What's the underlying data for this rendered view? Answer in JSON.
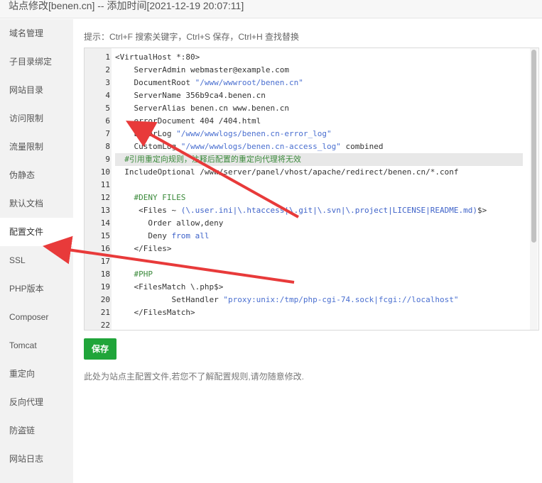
{
  "window": {
    "title": "站点修改[benen.cn] -- 添加时间[2021-12-19 20:07:11]"
  },
  "sidebar": {
    "items": [
      {
        "label": "域名管理",
        "active": false
      },
      {
        "label": "子目录绑定",
        "active": false
      },
      {
        "label": "网站目录",
        "active": false
      },
      {
        "label": "访问限制",
        "active": false
      },
      {
        "label": "流量限制",
        "active": false
      },
      {
        "label": "伪静态",
        "active": false
      },
      {
        "label": "默认文档",
        "active": false
      },
      {
        "label": "配置文件",
        "active": true
      },
      {
        "label": "SSL",
        "active": false
      },
      {
        "label": "PHP版本",
        "active": false
      },
      {
        "label": "Composer",
        "active": false
      },
      {
        "label": "Tomcat",
        "active": false
      },
      {
        "label": "重定向",
        "active": false
      },
      {
        "label": "反向代理",
        "active": false
      },
      {
        "label": "防盗链",
        "active": false
      },
      {
        "label": "网站日志",
        "active": false
      }
    ]
  },
  "main": {
    "hint": "提示：Ctrl+F 搜索关键字，Ctrl+S 保存，Ctrl+H 查找替换",
    "save_label": "保存",
    "note": "此处为站点主配置文件,若您不了解配置规则,请勿随意修改."
  },
  "editor": {
    "highlighted_line": 9,
    "lines": [
      {
        "n": "1",
        "text": "<VirtualHost *:80>"
      },
      {
        "n": "2",
        "text": "    ServerAdmin webmaster@example.com"
      },
      {
        "n": "3",
        "text": "    DocumentRoot \"/www/wwwroot/benen.cn\""
      },
      {
        "n": "4",
        "text": "    ServerName 356b9ca4.benen.cn"
      },
      {
        "n": "5",
        "text": "    ServerAlias benen.cn www.benen.cn"
      },
      {
        "n": "6",
        "text": "    errorDocument 404 /404.html"
      },
      {
        "n": "7",
        "text": "    ErrorLog \"/www/wwwlogs/benen.cn-error_log\""
      },
      {
        "n": "8",
        "text": "    CustomLog \"/www/wwwlogs/benen.cn-access_log\" combined"
      },
      {
        "n": "9",
        "text": "  #引用重定向规则，注释后配置的重定向代理将无效"
      },
      {
        "n": "10",
        "text": "  IncludeOptional /www/server/panel/vhost/apache/redirect/benen.cn/*.conf"
      },
      {
        "n": "11",
        "text": ""
      },
      {
        "n": "12",
        "text": "    #DENY FILES"
      },
      {
        "n": "13",
        "text": "     <Files ~ (\\.user.ini|\\.htaccess|\\.git|\\.svn|\\.project|LICENSE|README.md)$>"
      },
      {
        "n": "14",
        "text": "       Order allow,deny"
      },
      {
        "n": "15",
        "text": "       Deny from all"
      },
      {
        "n": "16",
        "text": "    </Files>"
      },
      {
        "n": "17",
        "text": ""
      },
      {
        "n": "18",
        "text": "    #PHP"
      },
      {
        "n": "19",
        "text": "    <FilesMatch \\.php$>"
      },
      {
        "n": "20",
        "text": "            SetHandler \"proxy:unix:/tmp/php-cgi-74.sock|fcgi://localhost\""
      },
      {
        "n": "21",
        "text": "    </FilesMatch>"
      },
      {
        "n": "22",
        "text": ""
      }
    ]
  },
  "colors": {
    "accent_green": "#20a53a",
    "annotation_red": "#e83a3a",
    "string_blue": "#4a6fd0",
    "comment_green": "#3b8a3b"
  }
}
